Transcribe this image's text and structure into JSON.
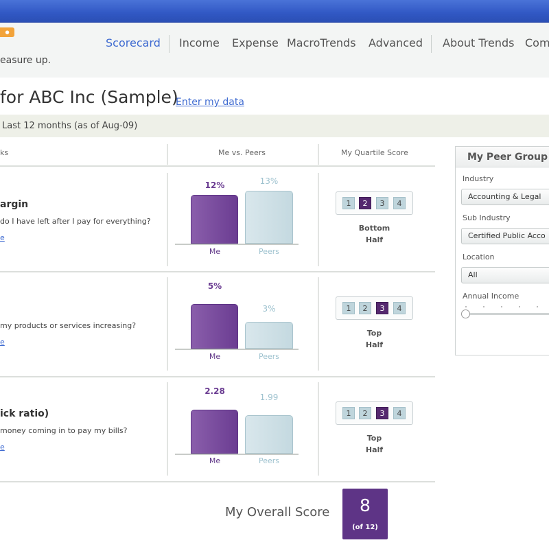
{
  "header": {
    "tagline": "easure up.",
    "tabs": [
      "Scorecard",
      "Income",
      "Expense",
      "MacroTrends",
      "Advanced",
      "About Trends",
      "Com"
    ]
  },
  "page": {
    "title": "for ABC Inc (Sample)",
    "enter_link": "Enter my data",
    "period": "Last 12 months (as of Aug-09)"
  },
  "columns": {
    "metrics": "ks",
    "me_vs_peers": "Me vs. Peers",
    "quartile": "My Quartile Score"
  },
  "metrics": [
    {
      "title": "argin",
      "question": "do I have left after I pay for everything?",
      "link": "e",
      "me_value_label": "12%",
      "peer_value_label": "13%",
      "me_value": 12,
      "peer_value": 13,
      "scale_max": 13.5,
      "me_label": "Me",
      "peer_label": "Peers",
      "quartiles": [
        "1",
        "2",
        "3",
        "4"
      ],
      "selected_quartile": 2,
      "standing_line1": "Bottom",
      "standing_line2": "Half"
    },
    {
      "title": "",
      "question": "my products or services increasing?",
      "link": "e",
      "me_value_label": "5%",
      "peer_value_label": "3%",
      "me_value": 5,
      "peer_value": 3,
      "scale_max": 6.2,
      "me_label": "Me",
      "peer_label": "Peers",
      "quartiles": [
        "1",
        "2",
        "3",
        "4"
      ],
      "selected_quartile": 3,
      "standing_line1": "Top",
      "standing_line2": "Half"
    },
    {
      "title": "ick ratio)",
      "question": "money coming in to pay my bills?",
      "link": "e",
      "me_value_label": "2.28",
      "peer_value_label": "1.99",
      "me_value": 2.28,
      "peer_value": 1.99,
      "scale_max": 2.85,
      "me_label": "Me",
      "peer_label": "Peers",
      "quartiles": [
        "1",
        "2",
        "3",
        "4"
      ],
      "selected_quartile": 3,
      "standing_line1": "Top",
      "standing_line2": "Half"
    }
  ],
  "overall": {
    "label": "My Overall Score",
    "score": "8",
    "of": "(of 12)"
  },
  "peer_group": {
    "title": "My Peer Group",
    "industry_label": "Industry",
    "industry_value": "Accounting & Legal",
    "sub_industry_label": "Sub Industry",
    "sub_industry_value": "Certified Public Acco",
    "location_label": "Location",
    "location_value": "All",
    "income_label": "Annual Income"
  },
  "colors": {
    "accent_purple": "#5e3486",
    "peer_blue": "#c4d9e0",
    "link_blue": "#3f6bd1",
    "topbar_blue": "#3158c4"
  }
}
